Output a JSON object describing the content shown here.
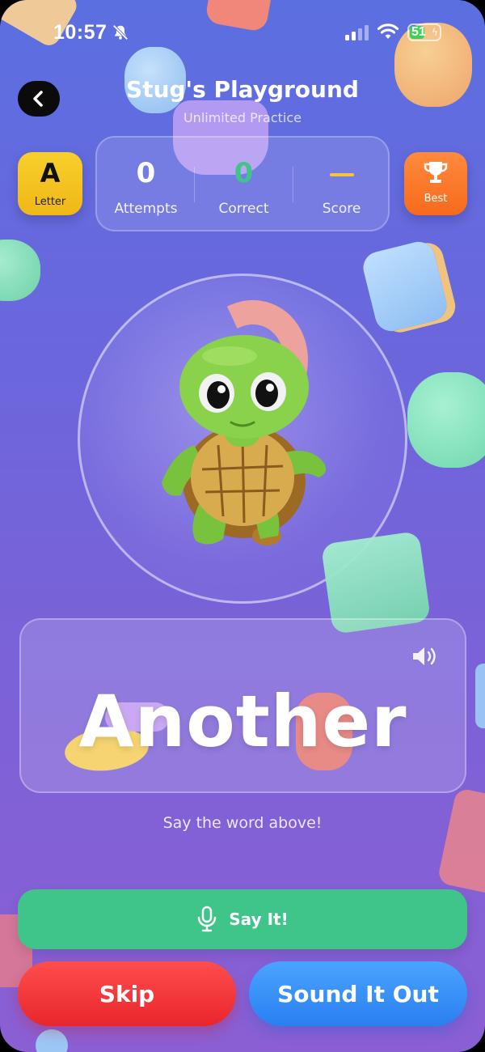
{
  "status_bar": {
    "time": "10:57",
    "battery_level": "51",
    "battery_fraction": 0.51,
    "icons": [
      "bell-slash-icon",
      "cellular-signal-icon",
      "wifi-icon",
      "battery-charging-icon"
    ]
  },
  "header": {
    "title": "Stug's Playground",
    "subtitle": "Unlimited Practice",
    "back_icon": "chevron-left-icon"
  },
  "mode": {
    "letter": "A",
    "label": "Letter"
  },
  "stats": {
    "attempts_value": "0",
    "attempts_label": "Attempts",
    "correct_value": "0",
    "correct_label": "Correct",
    "score_label": "Score"
  },
  "best": {
    "label": "Best",
    "icon": "trophy-icon"
  },
  "word_card": {
    "word": "Another",
    "speaker_icon": "speaker-icon"
  },
  "instruction": "Say the word above!",
  "actions": {
    "say_label": "Say It!",
    "say_icon": "microphone-icon",
    "skip_label": "Skip",
    "sound_label": "Sound It Out"
  },
  "colors": {
    "background_top": "#5b6fe0",
    "background_bottom": "#8b5fd4",
    "say_button": "#3fc489",
    "skip_button": "#e8262b",
    "sound_button": "#2a7ff0",
    "mode_button": "#f0b817",
    "best_button": "#f76a1c",
    "correct_value": "#3fc489",
    "score_dash": "#f5c43a"
  }
}
